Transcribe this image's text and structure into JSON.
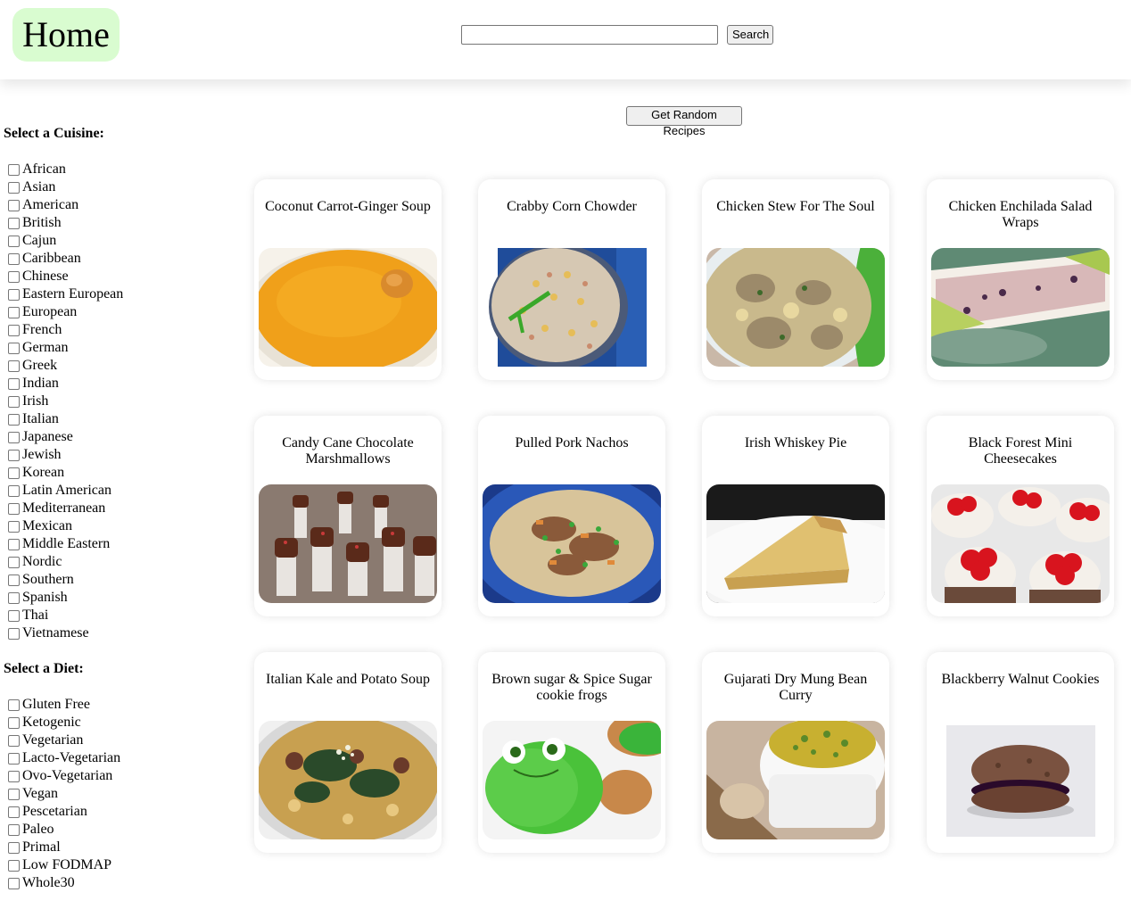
{
  "header": {
    "home_label": "Home",
    "search": {
      "value": "",
      "placeholder": ""
    },
    "search_button": "Search"
  },
  "random_button": "Get Random Recipes",
  "cuisine": {
    "title": "Select a Cuisine:",
    "options": [
      "African",
      "Asian",
      "American",
      "British",
      "Cajun",
      "Caribbean",
      "Chinese",
      "Eastern European",
      "European",
      "French",
      "German",
      "Greek",
      "Indian",
      "Irish",
      "Italian",
      "Japanese",
      "Jewish",
      "Korean",
      "Latin American",
      "Mediterranean",
      "Mexican",
      "Middle Eastern",
      "Nordic",
      "Southern",
      "Spanish",
      "Thai",
      "Vietnamese"
    ]
  },
  "diet": {
    "title": "Select a Diet:",
    "options": [
      "Gluten Free",
      "Ketogenic",
      "Vegetarian",
      "Lacto-Vegetarian",
      "Ovo-Vegetarian",
      "Vegan",
      "Pescetarian",
      "Paleo",
      "Primal",
      "Low FODMAP",
      "Whole30"
    ]
  },
  "recipes": [
    {
      "title": "Coconut Carrot-Ginger Soup",
      "image": "orange-soup-photo"
    },
    {
      "title": "Crabby Corn Chowder",
      "image": "corn-chowder-photo"
    },
    {
      "title": "Chicken Stew For The Soul",
      "image": "chicken-stew-photo"
    },
    {
      "title": "Chicken Enchilada Salad Wraps",
      "image": "salad-wrap-photo"
    },
    {
      "title": "Candy Cane Chocolate Marshmallows",
      "image": "marshmallow-photo"
    },
    {
      "title": "Pulled Pork Nachos",
      "image": "nachos-photo"
    },
    {
      "title": "Irish Whiskey Pie",
      "image": "pie-slice-photo"
    },
    {
      "title": "Black Forest Mini Cheesecakes",
      "image": "cheesecake-photo"
    },
    {
      "title": "Italian Kale and Potato Soup",
      "image": "kale-soup-photo"
    },
    {
      "title": "Brown sugar & Spice Sugar cookie frogs",
      "image": "frog-cookie-photo"
    },
    {
      "title": "Gujarati Dry Mung Bean Curry",
      "image": "mung-curry-photo"
    },
    {
      "title": "Blackberry Walnut Cookies",
      "image": "sandwich-cookie-photo"
    }
  ]
}
